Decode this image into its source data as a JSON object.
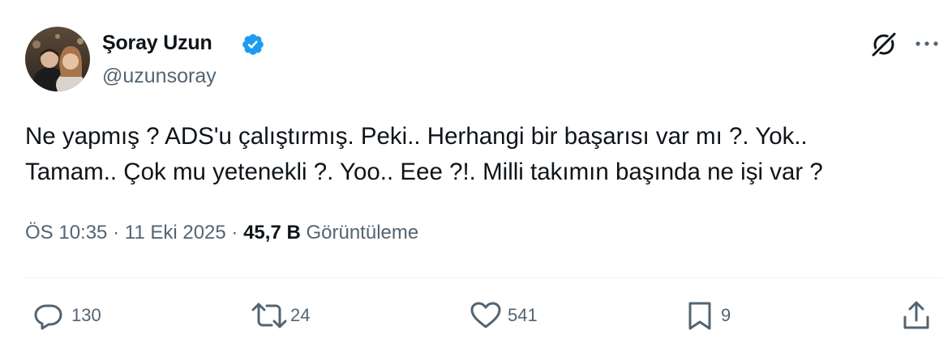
{
  "author": {
    "display_name": "Şoray Uzun",
    "handle": "@uzunsoray",
    "verified": true
  },
  "tweet": {
    "lines": [
      "Ne yapmış ? ADS'u çalıştırmış. Peki.. Herhangi bir başarısı var mı ?. Yok..",
      "Tamam.. Çok mu yetenekli ?. Yoo.. Eee ?!. Milli takımın başında ne işi var ?"
    ]
  },
  "meta": {
    "time": "ÖS 10:35",
    "separator": "·",
    "date": "11 Eki 2025",
    "views_count": "45,7 B",
    "views_label": "Görüntüleme"
  },
  "actions": {
    "replies": "130",
    "reposts": "24",
    "likes": "541",
    "bookmarks": "9"
  },
  "icons": {
    "badge": "verified-badge-icon",
    "grok": "grok-icon",
    "more": "more-icon",
    "reply": "reply-icon",
    "repost": "repost-icon",
    "like": "like-icon",
    "bookmark": "bookmark-icon",
    "share": "share-icon"
  },
  "colors": {
    "text": "#0f1419",
    "secondary": "#536471",
    "verified": "#1d9bf0",
    "divider": "#eff3f4"
  }
}
